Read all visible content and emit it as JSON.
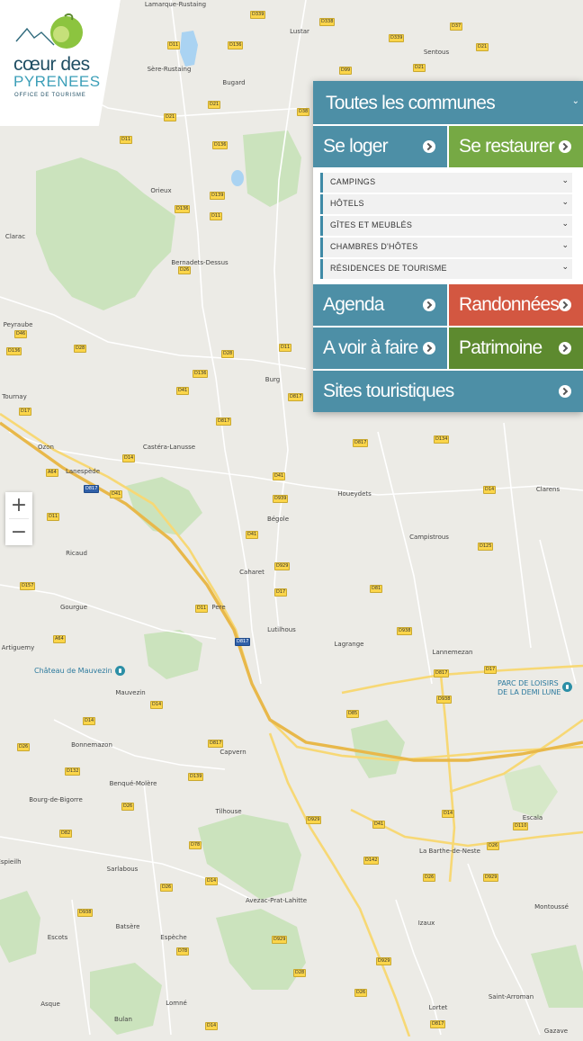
{
  "brand": {
    "line1": "cœur des",
    "line2": "PYRENEES",
    "line3": "OFFICE DE TOURISME"
  },
  "zoom": {
    "plus": "+",
    "minus": "−"
  },
  "menu": {
    "communes": "Toutes les communes",
    "se_loger": "Se loger",
    "se_restaurer": "Se restaurer",
    "sub_items": [
      "CAMPINGS",
      "HÔTELS",
      "GÎTES ET MEUBLÉS",
      "CHAMBRES D'HÔTES",
      "RÉSIDENCES DE TOURISME"
    ],
    "agenda": "Agenda",
    "randonnees": "Randonnées",
    "a_voir": "A voir à faire",
    "patrimoine": "Patrimoine",
    "sites": "Sites touristiques"
  },
  "map": {
    "places": [
      "Lamarque-Rustaing",
      "Lustar",
      "Sentous",
      "Sère-Rustaing",
      "Bugard",
      "Orieux",
      "Clarac",
      "Bernadets-Dessus",
      "Peyraube",
      "Tournay",
      "Burg",
      "Ozon",
      "Castéra-Lanusse",
      "Lanespède",
      "Houeydets",
      "Clarens",
      "Bégole",
      "Campistrous",
      "Ricaud",
      "Caharet",
      "Gourgue",
      "Pere",
      "Lutilhous",
      "Lagrange",
      "Lannemezan",
      "Artiguemy",
      "Mauvezin",
      "Bonnemazon",
      "Capvern",
      "Benqué-Molère",
      "Bourg-de-Bigorre",
      "Tilhouse",
      "Escala",
      "La Barthe-de-Neste",
      "Sarlabous",
      "Avezac-Prat-Lahitte",
      "Montoussé",
      "Espieilh",
      "Batsère",
      "Escots",
      "Espèche",
      "Izaux",
      "Asque",
      "Lomné",
      "Bulan",
      "Lortet",
      "Saint-Arroman",
      "Gazave"
    ],
    "pois": [
      "Château de Mauvezin",
      "PARC DE LOISIRS",
      "DE LA DEMI LUNE"
    ],
    "roads": [
      "D339",
      "D338",
      "D37",
      "D11",
      "D136",
      "D339",
      "D21",
      "D99",
      "D21",
      "D21",
      "D21",
      "D38",
      "D136",
      "D11",
      "D139",
      "D136",
      "D11",
      "D26",
      "D46",
      "D28",
      "D136",
      "D28",
      "D11",
      "D136",
      "D41",
      "D817",
      "D817",
      "D17",
      "D817",
      "D134",
      "D14",
      "A64",
      "D817",
      "D41",
      "D41",
      "D939",
      "D14",
      "D11",
      "D41",
      "D929",
      "D125",
      "D157",
      "D11",
      "D17",
      "D938",
      "D81",
      "A64",
      "D817",
      "D817",
      "D17",
      "D938",
      "D14",
      "D14",
      "D26",
      "D132",
      "D817",
      "D85",
      "D139",
      "D26",
      "D82",
      "D78",
      "D14",
      "D26",
      "D938",
      "D929",
      "D14",
      "D78",
      "D929",
      "D26",
      "D26",
      "D142",
      "D929",
      "D929",
      "D110",
      "D41",
      "D26",
      "D28",
      "D14",
      "D817"
    ],
    "pin_tag": "A64"
  }
}
